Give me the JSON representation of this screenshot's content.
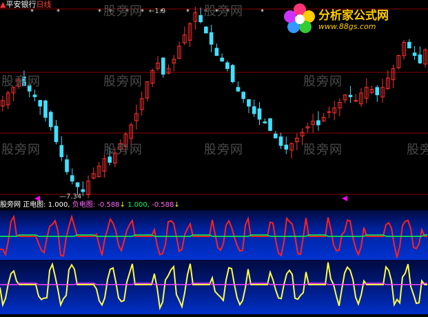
{
  "title_bar": {
    "caret": "▲",
    "stock_name": "平安银行",
    "period": "日线"
  },
  "logo": {
    "brand": "分析家公式网",
    "url": "www.88gs.com"
  },
  "price_labels": {
    "high": "1.9",
    "low": "7.34"
  },
  "top_markers": [
    "*",
    "*",
    "*",
    "*",
    "*",
    "*",
    "*",
    "*",
    "*",
    "*",
    "*",
    "*",
    "*",
    "*"
  ],
  "watermark_text": "股旁网",
  "indicator_bar": {
    "name": "股旁网",
    "positive_label": "正电图:",
    "positive_value": "1.000,",
    "negative_label": "负电图:",
    "negative_value": "-0.588",
    "arrow1": "↓",
    "value3": "1.000,",
    "value4": "-0.588",
    "arrow2": "↓"
  },
  "colors": {
    "candle_up": "#ff3030",
    "candle_down": "#40e0ff",
    "grid_line": "#8b0000",
    "positive_line": "#ff2020",
    "positive_flat": "#00ff40",
    "negative_line": "#ffff40",
    "negative_flat": "#ff40ff",
    "marker_magenta": "#ff00ff"
  },
  "chart_data": {
    "type": "candlestick",
    "price_high": 1.9,
    "price_low": 7.34,
    "close_series": [
      12.2,
      12.6,
      12.9,
      13.3,
      13.0,
      12.7,
      12.4,
      11.9,
      11.3,
      10.8,
      10.0,
      9.2,
      8.4,
      7.9,
      7.6,
      7.34,
      7.9,
      8.3,
      8.7,
      9.1,
      8.9,
      9.4,
      9.9,
      10.4,
      10.9,
      11.5,
      12.3,
      13.2,
      13.8,
      14.2,
      13.6,
      13.9,
      14.4,
      15.1,
      15.7,
      16.3,
      16.9,
      16.4,
      15.8,
      15.2,
      14.6,
      14.3,
      13.9,
      13.2,
      12.7,
      12.3,
      11.9,
      11.5,
      11.2,
      11.0,
      10.6,
      10.2,
      9.8,
      9.6,
      9.9,
      10.2,
      10.5,
      10.8,
      11.1,
      10.9,
      11.3,
      11.6,
      11.8,
      12.1,
      12.5,
      12.4,
      12.2,
      12.6,
      12.9,
      12.8,
      12.5,
      12.9,
      13.4,
      13.9,
      14.6,
      15.3,
      15.0,
      14.6,
      14.2,
      14.9
    ]
  }
}
